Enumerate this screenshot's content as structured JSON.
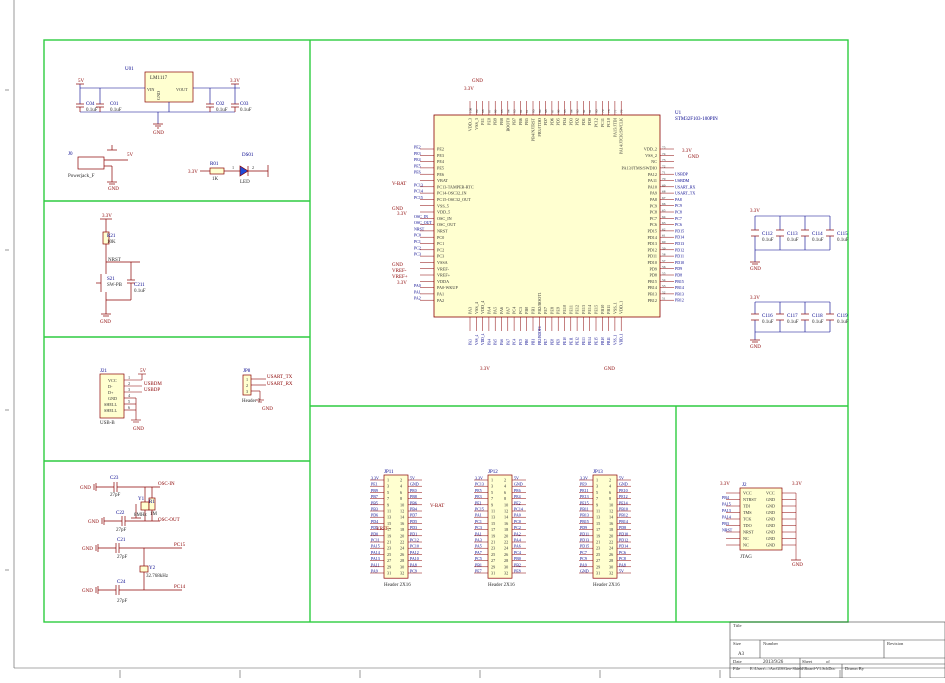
{
  "power": {
    "reg_ref": "U01",
    "reg_name": "LM1117",
    "pin_vin": "VIN",
    "pin_gnd": "GND",
    "pin_vout": "VOUT",
    "in_net": "5V",
    "out_net": "3.3V",
    "gnd": "GND",
    "caps": [
      {
        "ref": "C04",
        "val": "0.1uF"
      },
      {
        "ref": "C01",
        "val": "0.1uF"
      },
      {
        "ref": "C02",
        "val": "0.1uF"
      },
      {
        "ref": "C03",
        "val": "0.1uF"
      }
    ],
    "jack_ref": "J0",
    "jack_name": "Powerjack_F",
    "jack_net": "5V",
    "led_res_ref": "R01",
    "led_res_val": "1K",
    "led_ref": "DS01",
    "led_name": "LED",
    "led_net": "3.3V",
    "pin1": "1",
    "pin2": "2"
  },
  "reset": {
    "net": "3.3V",
    "r_ref": "R21",
    "r_val": "10K",
    "net_rst": "NRST",
    "sw_ref": "S21",
    "sw_name": "SW-PB",
    "c_ref": "C211",
    "c_val": "0.1uF",
    "gnd": "GND"
  },
  "usb": {
    "ref": "J21",
    "name": "USB-B",
    "net5v": "5V",
    "gnd": "GND",
    "pins": [
      "VCC",
      "D-",
      "D+",
      "GND",
      "SHELL",
      "SHELL"
    ],
    "nums": [
      "1",
      "2",
      "3",
      "4",
      "5",
      "6"
    ],
    "nets": [
      "USBDM",
      "USBDP"
    ]
  },
  "uart": {
    "ref": "JP8",
    "name": "Header 3",
    "nets": [
      "USART_TX",
      "USART_RX",
      "GND"
    ],
    "nums": [
      "1",
      "2",
      "3"
    ]
  },
  "osc": {
    "caps": [
      {
        "ref": "C23",
        "val": "27pF"
      },
      {
        "ref": "C22",
        "val": "27pF"
      },
      {
        "ref": "C21",
        "val": "27pF"
      },
      {
        "ref": "C24",
        "val": "27pF"
      }
    ],
    "y1_ref": "Y1",
    "y1_val": "8MHz",
    "r_ref": "R1",
    "r_val": "1M",
    "y2_ref": "Y2",
    "y2_val": "32.768kHz",
    "nets": [
      "OSC-IN",
      "OSC-OUT",
      "PC15",
      "PC14"
    ],
    "gnd": "GND"
  },
  "mcu": {
    "ref": "U1",
    "part": "STM32F103-100PIN",
    "gnd": "GND",
    "net33": "3.3V",
    "vbat": "V-BAT",
    "vref_p": "VREF+",
    "vref_m": "VREF-",
    "top_pins": [
      "VDD_3",
      "VSS_3",
      "PE1",
      "PE0",
      "PB9",
      "PB8",
      "BOOT0",
      "PB7",
      "PB6",
      "PB5",
      "PB4/NJTRST",
      "PB3/JTDO",
      "PD7",
      "PD6",
      "PD5",
      "PD4",
      "PD3",
      "PD2",
      "PD1",
      "PD0",
      "PC12",
      "PC11",
      "PC10",
      "PA15/JTDI",
      "PA14/JTCK/SWCLK"
    ],
    "top_nums": [
      "100",
      "99",
      "98",
      "97",
      "96",
      "95",
      "94",
      "93",
      "92",
      "91",
      "90",
      "89",
      "88",
      "87",
      "86",
      "85",
      "84",
      "83",
      "82",
      "81",
      "80",
      "79",
      "78",
      "77",
      "76"
    ],
    "left_pins": [
      "PE2",
      "PE3",
      "PE4",
      "PE5",
      "PE6",
      "VBAT",
      "PC13-TAMPER-RTC",
      "PC14-OSC32_IN",
      "PC15-OSC32_OUT",
      "VSS_5",
      "VDD_5",
      "OSC_IN",
      "OSC_OUT",
      "NRST",
      "PC0",
      "PC1",
      "PC2",
      "PC3",
      "VSSA",
      "VREF-",
      "VREF+",
      "VDDA",
      "PA0-WKUP",
      "PA1",
      "PA2"
    ],
    "left_nets": [
      "PE2",
      "PE3",
      "PE4",
      "PE5",
      "PE6",
      "",
      "PC13",
      "PC14",
      "PC15",
      "",
      "",
      "OSC_IN",
      "OSC_OUT",
      "NRST",
      "PC0",
      "PC1",
      "PC2",
      "PC3",
      "",
      "",
      "",
      "",
      "PA0",
      "PA1",
      "PA2"
    ],
    "right_pins": [
      "VDD_2",
      "VSS_2",
      "NC",
      "PA13/JTMS/SWDIO",
      "PA12",
      "PA11",
      "PA10",
      "PA9",
      "PA8",
      "PC9",
      "PC8",
      "PC7",
      "PC6",
      "PD15",
      "PD14",
      "PD13",
      "PD12",
      "PD11",
      "PD10",
      "PD9",
      "PD8",
      "PB15",
      "PB14",
      "PB13",
      "PB12"
    ],
    "right_nums": [
      "75",
      "74",
      "73",
      "72",
      "71",
      "70",
      "69",
      "68",
      "67",
      "66",
      "65",
      "64",
      "63",
      "62",
      "61",
      "60",
      "59",
      "58",
      "57",
      "56",
      "55",
      "54",
      "53",
      "52",
      "51"
    ],
    "right_nets": [
      "",
      "",
      "",
      "",
      "USBDP",
      "USBDM",
      "USART_RX",
      "USART_TX",
      "PA8",
      "PC9",
      "PC8",
      "PC7",
      "PC6",
      "PD15",
      "PD14",
      "PD13",
      "PD12",
      "PD11",
      "PD10",
      "PD9",
      "PD8",
      "PB15",
      "PB14",
      "PB13",
      "PB12"
    ],
    "bottom_pins": [
      "PA3",
      "VSS_4",
      "VDD_4",
      "PA4",
      "PA5",
      "PA6",
      "PA7",
      "PC4",
      "PC5",
      "PB0",
      "PB1",
      "PB2/BOOT1",
      "PE7",
      "PE8",
      "PE9",
      "PE10",
      "PE11",
      "PE12",
      "PE13",
      "PE14",
      "PE15",
      "PB10",
      "PB11",
      "VSS_1",
      "VDD_1"
    ]
  },
  "decoupling": {
    "net": "3.3V",
    "gnd": "GND",
    "row1": [
      {
        "ref": "C112",
        "val": "0.1uF"
      },
      {
        "ref": "C113",
        "val": "0.1uF"
      },
      {
        "ref": "C114",
        "val": "0.1uF"
      },
      {
        "ref": "C115",
        "val": "0.1uF"
      }
    ],
    "row2": [
      {
        "ref": "C116",
        "val": "0.1uF"
      },
      {
        "ref": "C117",
        "val": "0.1uF"
      },
      {
        "ref": "C118",
        "val": "0.1uF"
      },
      {
        "ref": "C119",
        "val": "0.1uF"
      }
    ]
  },
  "headers": [
    {
      "ref": "JP11",
      "name": "Header 2X16",
      "left": [
        "3.3V",
        "PE1",
        "PB9",
        "PB7",
        "PB5",
        "PB3",
        "PD6",
        "PD4",
        "PD2",
        "PD0",
        "PC11",
        "PA15",
        "PA14",
        "PA13",
        "PA11",
        "PA9"
      ],
      "right": [
        "5V",
        "GND",
        "PE0",
        "PB8",
        "PB6",
        "PB4",
        "PD7",
        "PD5",
        "PD3",
        "PD1",
        "PC12",
        "PC10",
        "PA12",
        "PA10",
        "PA8",
        "PC9"
      ],
      "extra": "V-BAT",
      "extra2": "VREF-"
    },
    {
      "ref": "JP12",
      "name": "Header 2X16",
      "left": [
        "3.3V",
        "PC13",
        "PE5",
        "PE3",
        "PE1",
        "PC15",
        "PA1",
        "PC1",
        "PC3",
        "PA1",
        "PA3",
        "PA5",
        "PA7",
        "PC5",
        "PB1",
        "PE7"
      ],
      "right": [
        "5V",
        "GND",
        "PE6",
        "PE4",
        "PE2",
        "PC14",
        "PA0",
        "PC0",
        "PC2",
        "PA2",
        "PA4",
        "PA6",
        "PC4",
        "PB0",
        "PB2",
        "PE8"
      ]
    },
    {
      "ref": "JP13",
      "name": "Header 2X16",
      "left": [
        "3.3V",
        "PE9",
        "PE11",
        "PE13",
        "PE15",
        "PB11",
        "PB13",
        "PB15",
        "PD9",
        "PD11",
        "PD13",
        "PD15",
        "PC7",
        "PC9",
        "PA9",
        "GND"
      ],
      "right": [
        "5V",
        "GND",
        "PE10",
        "PE12",
        "PE14",
        "PB10",
        "PB12",
        "PB14",
        "PD8",
        "PD10",
        "PD12",
        "PD14",
        "PC6",
        "PC8",
        "PA8",
        "5V"
      ]
    }
  ],
  "jtag": {
    "ref": "J2",
    "name": "JTAG",
    "net": "3.3V",
    "gnd": "GND",
    "left": [
      "VCC",
      "NTRST",
      "TDI",
      "TMS",
      "TCK",
      "TDO",
      "NRST",
      "NC",
      "NC"
    ],
    "right": [
      "VCC",
      "GND",
      "GND",
      "GND",
      "GND",
      "GND",
      "GND",
      "GND",
      "GND"
    ],
    "nets": [
      "PB4",
      "PA15",
      "PA13",
      "PA14",
      "PB3",
      "NRST"
    ]
  },
  "title_block": {
    "title_label": "Title",
    "size_label": "Size",
    "size_val": "A3",
    "number_label": "Number",
    "revision_label": "Revision",
    "date_label": "Date",
    "date_val": "2013/9/26",
    "file_label": "File",
    "file_val": "E:\\Users\\...\\ArcGIS\\Geo-Shield\\Board-V1.SchDoc",
    "sheet_label": "Sheet",
    "of_label": "of",
    "drawn_label": "Drawn By"
  }
}
